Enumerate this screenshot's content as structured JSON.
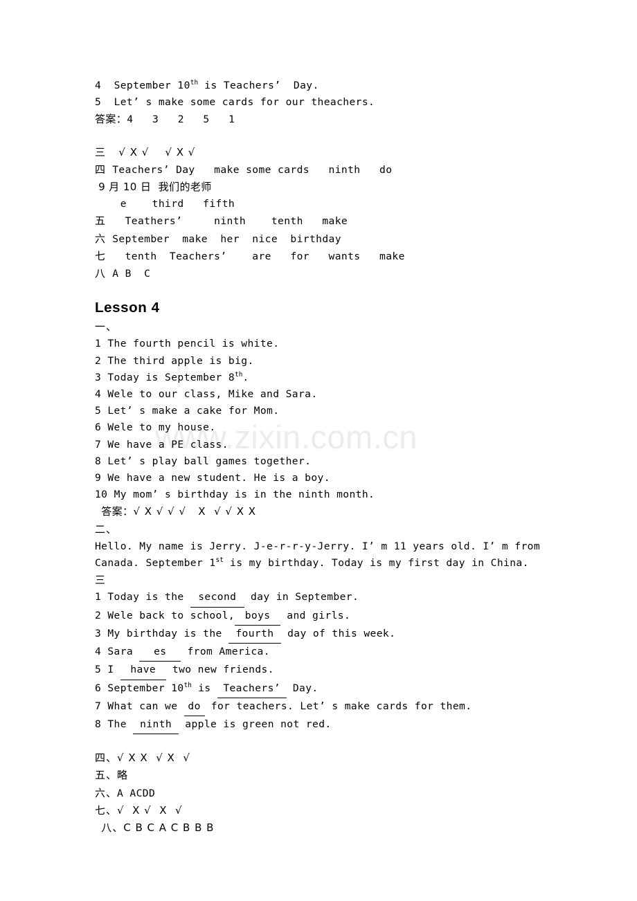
{
  "document": {
    "watermark": "www.zixin.com.cn"
  },
  "lesson3_tail": {
    "items": [
      {
        "num": "4",
        "pre": "September 10",
        "sup": "th",
        "post": " is Teachers’  Day."
      },
      {
        "num": "5",
        "text": "Let’ s make some cards for our theachers."
      }
    ],
    "answer_label": "答案：",
    "answer_values": "4   3   2   5   1"
  },
  "sections": [
    {
      "marker": "三",
      "content": "√ X √    √ X √"
    },
    {
      "marker": "四",
      "content": "Teachers’ Day   make some cards   ninth   do"
    },
    {
      "marker": "",
      "content": " 9 月 10 日  我们的老师"
    },
    {
      "marker": "",
      "content": "    e    third   fifth"
    },
    {
      "marker": "五",
      "content": "  Teathers’     ninth    tenth   make"
    },
    {
      "marker": "六",
      "content": "September  make  her  nice  birthday"
    },
    {
      "marker": "七",
      "content": "  tenth  Teachers’    are   for   wants   make"
    },
    {
      "marker": "八",
      "content": "A B  C"
    }
  ],
  "lesson4": {
    "title": "Lesson 4",
    "part1_marker": "一、",
    "part1_items": [
      {
        "num": "1",
        "text": "The fourth pencil is white."
      },
      {
        "num": "2",
        "text": "The third apple is big."
      },
      {
        "num": "3",
        "pre": "Today is September 8",
        "sup": "th",
        "post": "."
      },
      {
        "num": "4",
        "text": "Wele to our class, Mike and Sara."
      },
      {
        "num": "5",
        "text": "Let’ s make a cake for Mom."
      },
      {
        "num": "6",
        "text": "Wele to my house."
      },
      {
        "num": "7",
        "text": "We have a PE class."
      },
      {
        "num": "8",
        "text": "Let’ s play ball games together."
      },
      {
        "num": "9",
        "text": "We have a new student. He is a boy."
      },
      {
        "num": "10",
        "text": "My mom’ s birthday is in the ninth month."
      }
    ],
    "part1_answer_label": "答案：",
    "part1_answer_values": "√ X √ √ √   X  √ √ X X",
    "part2_marker": "二、",
    "part2_line1": "Hello. My name is Jerry. J-e-r-r-y-Jerry. I’ m 11 years old. I’ m from",
    "part2_line2_pre": "Canada. September 1",
    "part2_line2_sup": "st",
    "part2_line2_post": " is my birthday. Today is my first day in China.",
    "part3_marker": "三",
    "part3_items": [
      {
        "num": "1",
        "pre": "Today is the ",
        "blank": "second",
        "post": " day in September."
      },
      {
        "num": "2",
        "pre": "Wele back to school,",
        "blank": "boys",
        "post": " and girls."
      },
      {
        "num": "3",
        "pre": "My birthday is the ",
        "blank": "fourth",
        "post": " day of this week."
      },
      {
        "num": "4",
        "pre": "Sara ",
        "blank": "es",
        "post": " from America."
      },
      {
        "num": "5",
        "pre": "I ",
        "blank": "have",
        "post": " two new friends."
      },
      {
        "num": "6",
        "pre": "September 10",
        "sup": "th",
        "mid": " is ",
        "blank": "Teachers’",
        "post": " Day."
      },
      {
        "num": "7",
        "pre": "What can we ",
        "blank": "do",
        "post": " for teachers. Let’ s make cards for them."
      },
      {
        "num": "8",
        "pre": "The ",
        "blank": "ninth",
        "post": " apple is green not red."
      }
    ],
    "tail_sections": [
      {
        "marker": "四、",
        "content": "√ X X  √ X  √"
      },
      {
        "marker": "五、",
        "content": "略"
      },
      {
        "marker": "六、",
        "content": "A ACDD"
      },
      {
        "marker": "七、",
        "content": "√  X √  X  √"
      },
      {
        "marker": "八、",
        "content": "C B C A C B B B"
      }
    ]
  }
}
